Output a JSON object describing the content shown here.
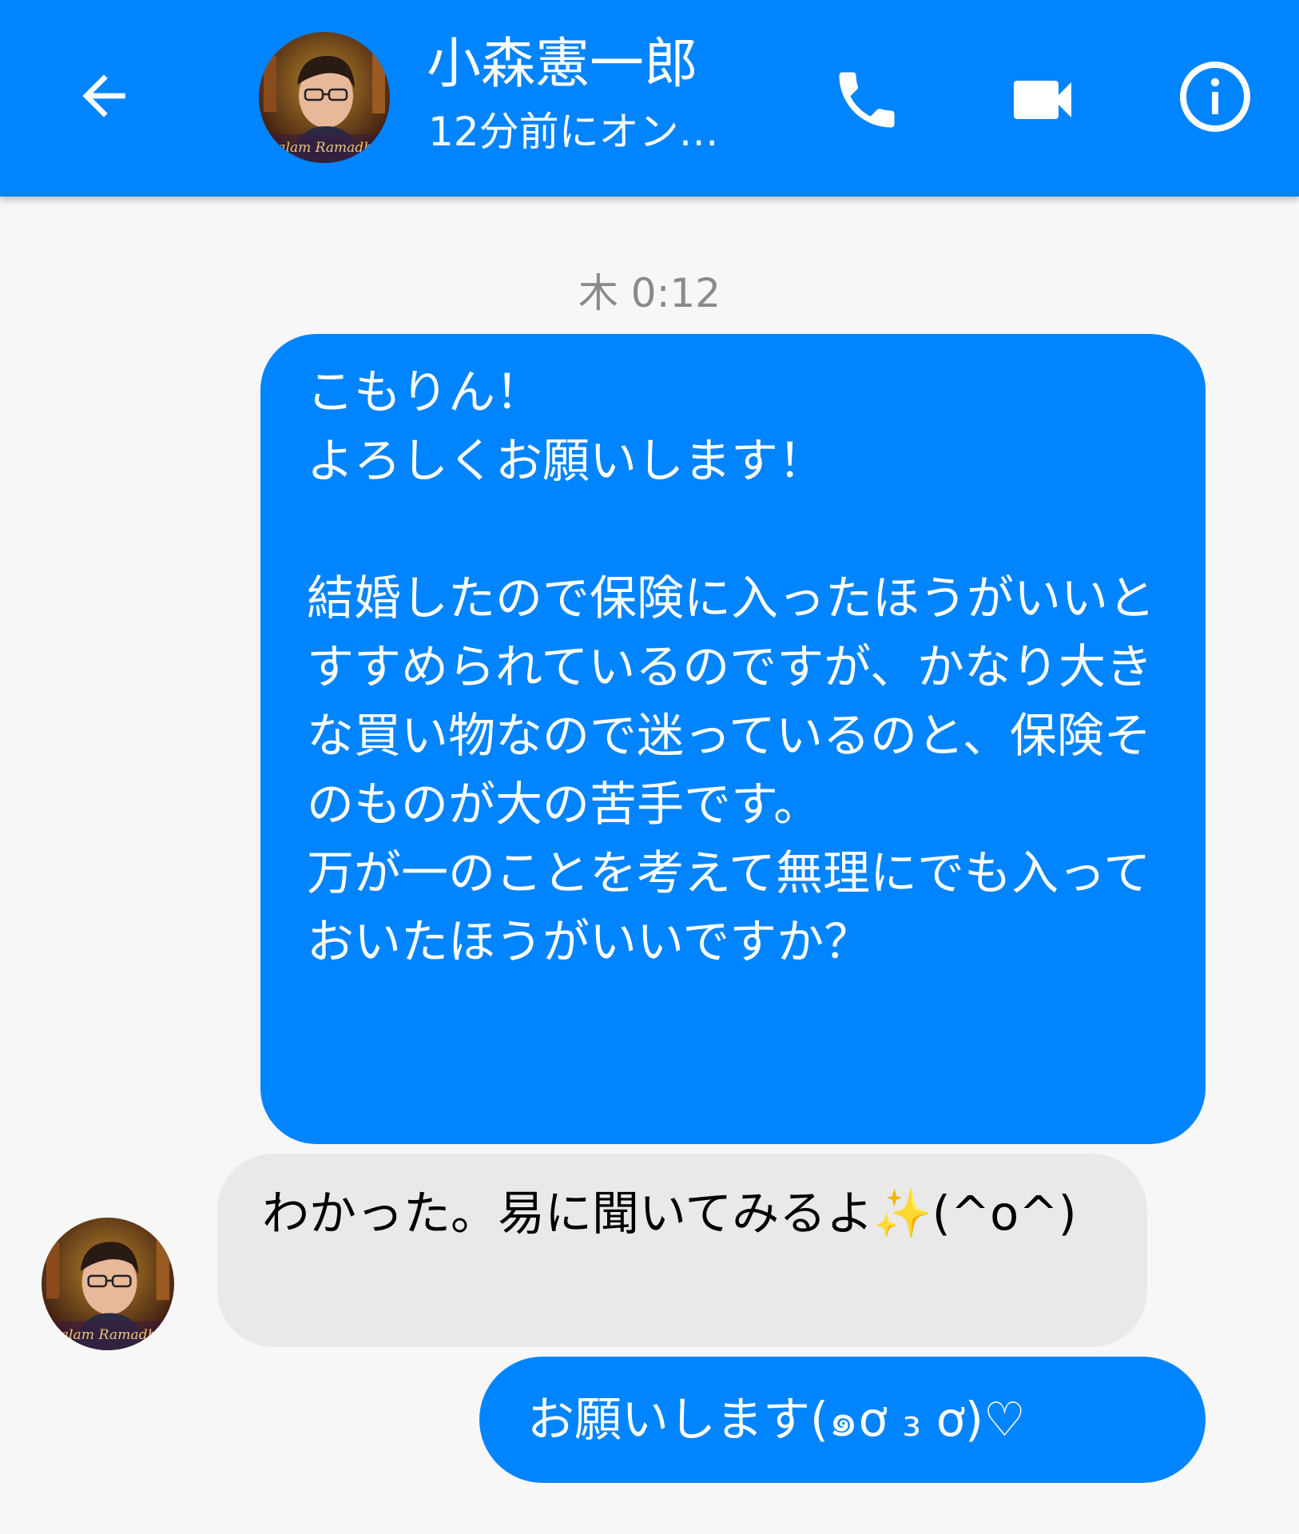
{
  "header": {
    "contact_name": "小森憲一郎",
    "status": "12分前にオン…",
    "avatar_caption": "Salam Ramadha",
    "icons": {
      "back": "arrow-left-icon",
      "call": "phone-icon",
      "video": "video-camera-icon",
      "info": "info-icon"
    }
  },
  "conversation": {
    "timestamp": "木 0:12",
    "messages": [
      {
        "direction": "outgoing",
        "text": "こもりん！\nよろしくお願いします！\n\n結婚したので保険に入ったほうがいいとすすめられているのですが、かなり大きな買い物なので迷っているのと、保険そのものが大の苦手です。\n万が一のことを考えて無理にでも入っておいたほうがいいですか？"
      },
      {
        "direction": "incoming",
        "text": "わかった。易に聞いてみるよ✨(^o^)"
      },
      {
        "direction": "outgoing",
        "text": "お願いします(๑ơ ₃ ơ)♡"
      }
    ]
  },
  "colors": {
    "brand_blue": "#0084ff",
    "incoming_bubble": "#e9e9e9",
    "background": "#f7f7f7"
  }
}
